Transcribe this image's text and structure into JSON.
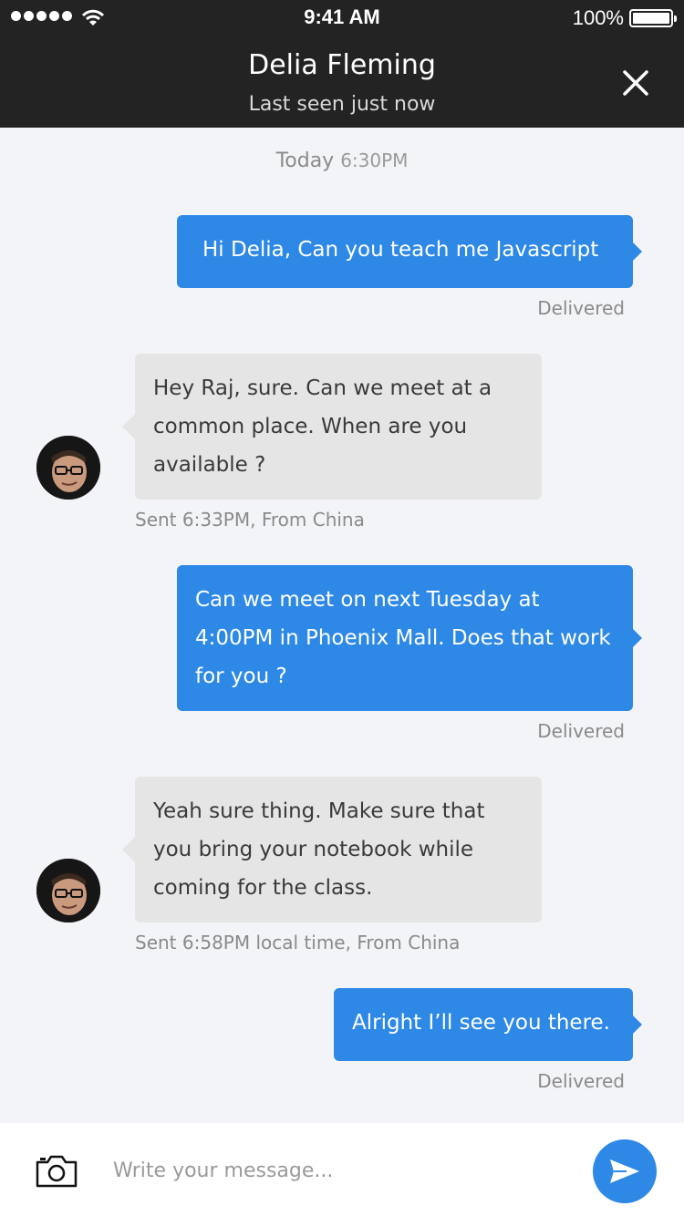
{
  "status_bar": {
    "time": "9:41 AM",
    "battery_pct": "100%",
    "battery_level": 1.0,
    "signal_bars": 5
  },
  "header": {
    "name": "Delia Fleming",
    "subtitle": "Last seen just now"
  },
  "date_divider": {
    "day": "Today",
    "time": "6:30PM"
  },
  "messages": [
    {
      "direction": "out",
      "text": "Hi Delia, Can you teach me Javascript",
      "meta": "Delivered"
    },
    {
      "direction": "in",
      "text": "Hey Raj, sure. Can we meet at a common place. When are you available ?",
      "meta": "Sent 6:33PM, From China"
    },
    {
      "direction": "out",
      "text": "Can we meet on next Tuesday at 4:00PM in Phoenix Mall. Does that work for you ?",
      "meta": "Delivered"
    },
    {
      "direction": "in",
      "text": "Yeah sure thing. Make sure that you bring your notebook while coming for the class.",
      "meta": "Sent 6:58PM local time, From China"
    },
    {
      "direction": "out",
      "text": "Alright I’ll see you there.",
      "meta": "Delivered"
    }
  ],
  "composer": {
    "placeholder": "Write your message...",
    "value": ""
  },
  "colors": {
    "accent": "#2e88e6",
    "header_bg": "#232323",
    "incoming_bubble": "#e5e5e5",
    "background": "#f3f4f8"
  },
  "icons": {
    "close": "close-icon",
    "camera": "camera-icon",
    "send": "send-icon",
    "wifi": "wifi-icon",
    "battery": "battery-icon"
  }
}
